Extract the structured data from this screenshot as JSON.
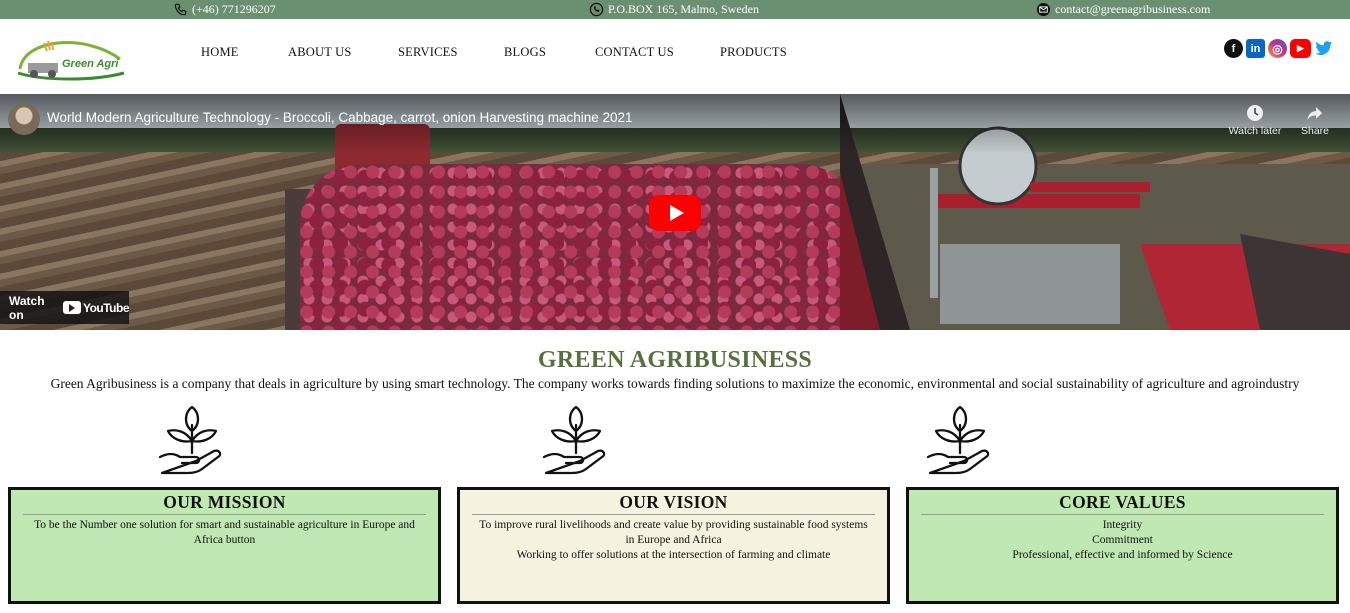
{
  "topbar": {
    "phone": "(+46) 771296207",
    "address": "P.O.BOX 165, Malmo, Sweden",
    "email": "contact@greenagribusiness.com"
  },
  "logo": {
    "text": "Green Agri"
  },
  "nav": {
    "items": [
      {
        "label": "HOME"
      },
      {
        "label": "ABOUT US"
      },
      {
        "label": "SERVICES"
      },
      {
        "label": "BLOGS"
      },
      {
        "label": "CONTACT US"
      },
      {
        "label": "PRODUCTS"
      }
    ]
  },
  "social": [
    {
      "name": "facebook-icon",
      "glyph": "f",
      "color": "#111111"
    },
    {
      "name": "linkedin-icon",
      "glyph": "in",
      "color": "#0a66c2"
    },
    {
      "name": "instagram-icon",
      "glyph": "◎",
      "color": "#c13584"
    },
    {
      "name": "youtube-icon",
      "glyph": "▶",
      "color": "#ff0000"
    },
    {
      "name": "twitter-icon",
      "glyph": "🐦",
      "color": "#1da1f2"
    }
  ],
  "video": {
    "title": "World Modern Agriculture Technology - Broccoli, Cabbage, carrot, onion Harvesting machine 2021",
    "watch_later": "Watch later",
    "share": "Share",
    "watch_on": "Watch on",
    "youtube": "YouTube"
  },
  "about": {
    "heading": "GREEN AGRIBUSINESS",
    "intro": "Green Agribusiness is a company that deals in agriculture by using smart technology. The company works towards finding solutions to maximize the economic, environmental and social sustainability of agriculture and agroindustry"
  },
  "cards": {
    "mission": {
      "title": "OUR MISSION",
      "lines": [
        "To be the Number one solution for smart and sustainable agriculture in Europe and Africa button"
      ]
    },
    "vision": {
      "title": "OUR VISION",
      "lines": [
        "To improve rural livelihoods and create value by providing sustainable food systems in Europe and Africa",
        "Working to offer solutions at the intersection of farming and climate"
      ]
    },
    "values": {
      "title": "CORE VALUES",
      "lines": [
        "Integrity",
        "Commitment",
        "Professional, effective and informed by Science"
      ]
    }
  },
  "colors": {
    "topbar": "#6b8f71",
    "heading": "#56703f",
    "card_green": "#bfe8b3",
    "card_cream": "#f5f3df"
  }
}
